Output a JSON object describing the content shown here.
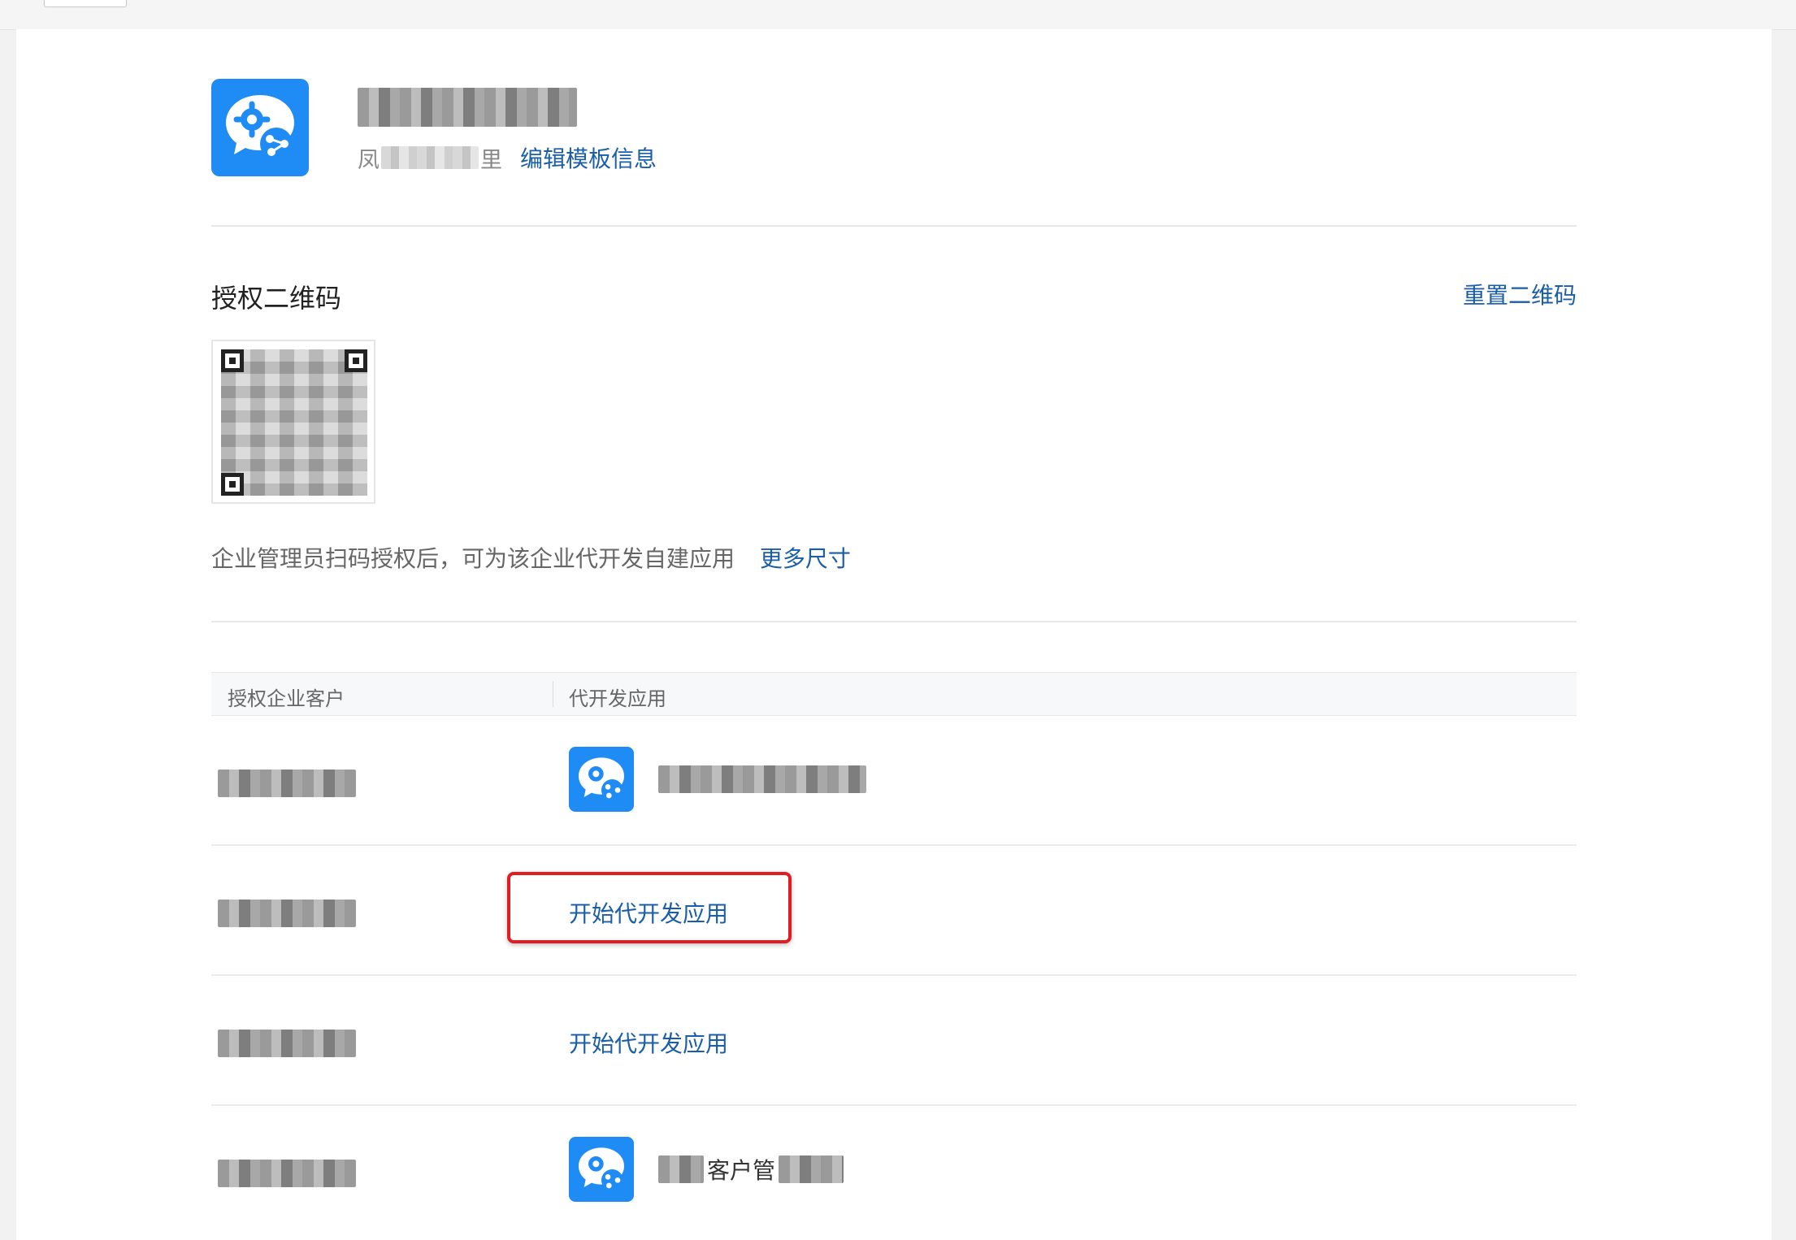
{
  "header": {
    "app_name_redacted": true,
    "subtitle_prefix": "凤",
    "subtitle_suffix": "里",
    "edit_link": "编辑模板信息"
  },
  "qr_section": {
    "title": "授权二维码",
    "reset_link": "重置二维码",
    "description": "企业管理员扫码授权后，可为该企业代开发自建应用",
    "more_size_link": "更多尺寸"
  },
  "table": {
    "columns": [
      "授权企业客户",
      "代开发应用"
    ],
    "rows": [
      {
        "app_name_redacted": true
      },
      {
        "action": "开始代开发应用"
      },
      {
        "action": "开始代开发应用"
      },
      {
        "app_name_fragment": "客户管"
      }
    ]
  },
  "colors": {
    "accent_link": "#1a5ea8",
    "app_icon_bg": "#1f8cf5",
    "highlight_box": "#e31b23"
  }
}
